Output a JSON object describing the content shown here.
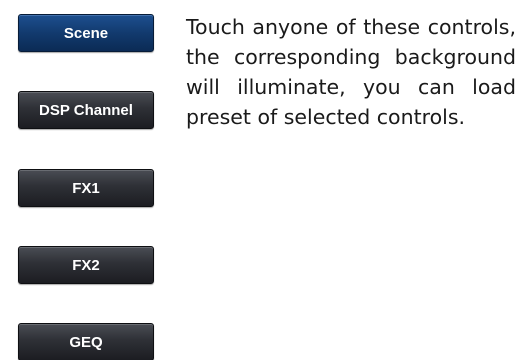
{
  "controls": {
    "scene": "Scene",
    "dsp_channel": "DSP Channel",
    "fx1": "FX1",
    "fx2": "FX2",
    "geq": "GEQ"
  },
  "description": "Touch anyone of these controls, the corresponding background will illuminate, you can load preset of selected controls.",
  "colors": {
    "active_button": "#123a6e",
    "inactive_button": "#2e3036",
    "button_text": "#ffffff"
  }
}
